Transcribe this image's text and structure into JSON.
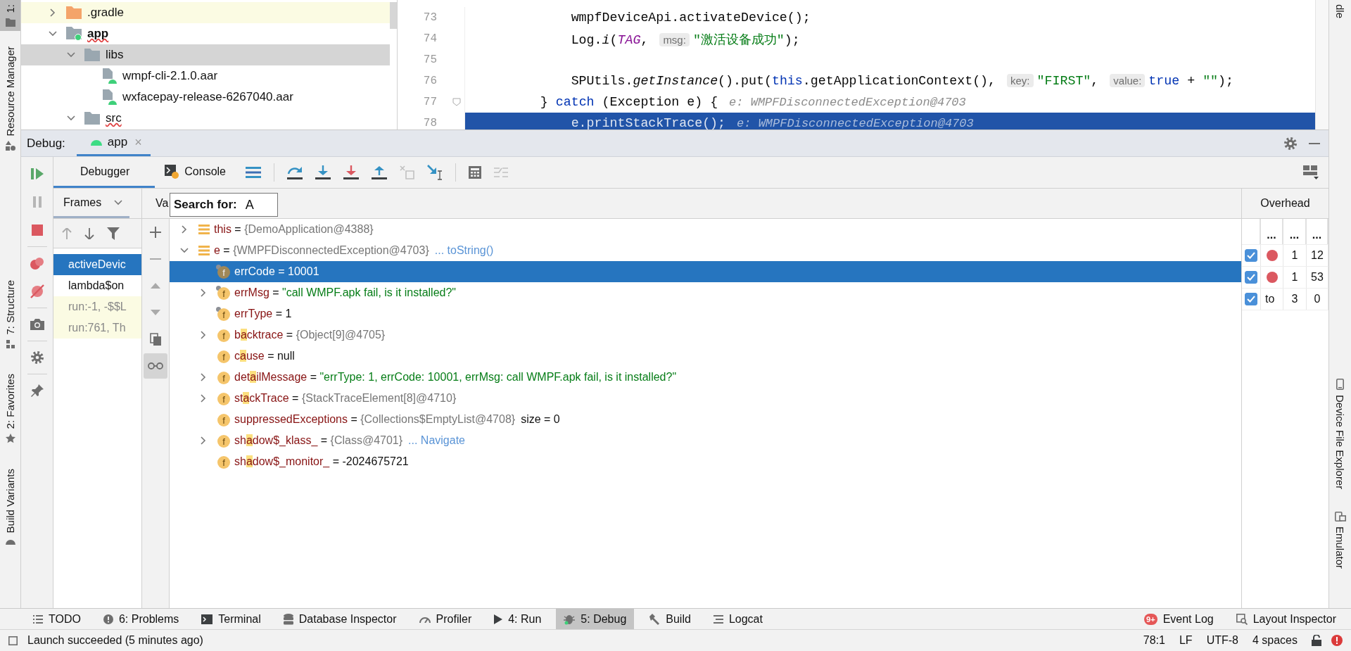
{
  "left_strip": [
    {
      "label": "1:",
      "kind": "project",
      "selected": true
    },
    {
      "label": "Resource Manager",
      "kind": "resources",
      "selected": false
    },
    {
      "label": "7: Structure",
      "kind": "structure",
      "selected": false
    },
    {
      "label": "2: Favorites",
      "kind": "favorites",
      "selected": false
    },
    {
      "label": "Build Variants",
      "kind": "variants",
      "selected": false
    }
  ],
  "right_strip": [
    {
      "label": "dle",
      "kind": "gradle"
    },
    {
      "label": "Device File Explorer",
      "kind": "device"
    },
    {
      "label": "Emulator",
      "kind": "emulator"
    }
  ],
  "project_tree": [
    {
      "label": ".gradle",
      "kind": "folder",
      "expanded": false,
      "excluded": true,
      "selected": false,
      "warning": false
    },
    {
      "label": "app",
      "kind": "module",
      "expanded": true,
      "excluded": false,
      "selected": false,
      "warning": true,
      "children": [
        {
          "label": "libs",
          "kind": "folder",
          "expanded": true,
          "excluded": false,
          "selected": true,
          "warning": false,
          "children": [
            {
              "label": "wmpf-cli-2.1.0.aar",
              "kind": "archive",
              "excluded": false,
              "selected": false,
              "warning": false
            },
            {
              "label": "wxfacepay-release-6267040.aar",
              "kind": "archive",
              "excluded": false,
              "selected": false,
              "warning": false
            }
          ]
        },
        {
          "label": "src",
          "kind": "folder",
          "expanded": true,
          "excluded": false,
          "selected": false,
          "warning": true
        }
      ]
    }
  ],
  "editor": {
    "lines": [
      {
        "number": "73",
        "current": false,
        "fold": false,
        "tokens": [
          {
            "kind": "plain",
            "text": "            wmpfDeviceApi.activateDevice();"
          }
        ]
      },
      {
        "number": "74",
        "current": false,
        "fold": false,
        "tokens": [
          {
            "kind": "plain",
            "text": "            Log."
          },
          {
            "kind": "italic",
            "text": "i"
          },
          {
            "kind": "plain",
            "text": "("
          },
          {
            "kind": "constant",
            "text": "TAG"
          },
          {
            "kind": "plain",
            "text": ", "
          },
          {
            "kind": "hint",
            "text": "msg:"
          },
          {
            "kind": "string",
            "text": "\"激活设备成功\""
          },
          {
            "kind": "plain",
            "text": ");"
          }
        ]
      },
      {
        "number": "75",
        "current": false,
        "fold": false
      },
      {
        "number": "76",
        "current": false,
        "fold": false,
        "tokens": [
          {
            "kind": "plain",
            "text": "            SPUtils."
          },
          {
            "kind": "italic",
            "text": "getInstance"
          },
          {
            "kind": "plain",
            "text": "().put("
          },
          {
            "kind": "keyword",
            "text": "this"
          },
          {
            "kind": "plain",
            "text": ".getApplicationContext(), "
          },
          {
            "kind": "hint",
            "text": "key:"
          },
          {
            "kind": "string",
            "text": "\"FIRST\""
          },
          {
            "kind": "plain",
            "text": ", "
          },
          {
            "kind": "hint",
            "text": "value:"
          },
          {
            "kind": "keyword",
            "text": "true"
          },
          {
            "kind": "plain",
            "text": " + "
          },
          {
            "kind": "string",
            "text": "\"\""
          },
          {
            "kind": "plain",
            "text": ");"
          }
        ]
      },
      {
        "number": "77",
        "current": false,
        "fold": true,
        "tokens": [
          {
            "kind": "plain",
            "text": "        } "
          },
          {
            "kind": "keyword",
            "text": "catch"
          },
          {
            "kind": "plain",
            "text": " (Exception e) {"
          }
        ],
        "inline_value": "e: WMPFDisconnectedException@4703"
      },
      {
        "number": "78",
        "current": true,
        "fold": false,
        "tokens": [
          {
            "kind": "plain",
            "text": "            e.printStackTrace();"
          }
        ],
        "inline_value": "e: WMPFDisconnectedException@4703"
      }
    ]
  },
  "debug": {
    "title": "Debug:",
    "sessions": [
      {
        "label": "app",
        "close": "×",
        "selected": true
      }
    ],
    "side_buttons": [
      {
        "kind": "resume",
        "disabled": false
      },
      {
        "kind": "pause",
        "disabled": true
      },
      {
        "kind": "stop",
        "disabled": false
      },
      {
        "kind": "breakpoints",
        "disabled": false
      },
      {
        "kind": "mute",
        "disabled": false
      },
      {
        "kind": "camera",
        "disabled": false
      },
      {
        "kind": "settings",
        "disabled": false
      },
      {
        "kind": "pin",
        "disabled": false
      }
    ],
    "tabs": [
      {
        "label": "Debugger",
        "kind": "debugger",
        "selected": true
      },
      {
        "label": "Console",
        "kind": "console",
        "selected": false
      }
    ],
    "toolbar": [
      {
        "kind": "show-execution-point",
        "disabled": false
      },
      {
        "kind": "step-over",
        "disabled": false
      },
      {
        "kind": "step-into",
        "disabled": false
      },
      {
        "kind": "force-step-into",
        "disabled": false
      },
      {
        "kind": "step-out",
        "disabled": false
      },
      {
        "kind": "drop-frame",
        "disabled": true
      },
      {
        "kind": "run-to-cursor",
        "disabled": false
      },
      {
        "kind": "evaluate",
        "disabled": false
      },
      {
        "kind": "trace",
        "disabled": true
      }
    ],
    "frames": {
      "title": "Frames",
      "tools": [
        {
          "kind": "up",
          "disabled": true
        },
        {
          "kind": "down",
          "disabled": false
        },
        {
          "kind": "filter",
          "disabled": false
        }
      ],
      "items": [
        {
          "label": "activeDevic",
          "selected": true,
          "library": false
        },
        {
          "label": "lambda$on",
          "selected": false,
          "library": false
        },
        {
          "label": "run:-1, -$$L",
          "selected": false,
          "library": true
        },
        {
          "label": "run:761, Th",
          "selected": false,
          "library": true
        }
      ]
    },
    "variables": {
      "title": "Va",
      "search": {
        "label": "Search for:",
        "value": "A"
      },
      "tools": [
        {
          "kind": "add",
          "disabled": false,
          "selected": false
        },
        {
          "kind": "remove",
          "disabled": true,
          "selected": false
        },
        {
          "kind": "up",
          "disabled": true,
          "selected": false
        },
        {
          "kind": "down",
          "disabled": true,
          "selected": false
        },
        {
          "kind": "copy",
          "disabled": false,
          "selected": false
        },
        {
          "kind": "watches",
          "disabled": false,
          "selected": true
        }
      ],
      "items": [
        {
          "kind": "watch",
          "name": [
            "this"
          ],
          "sep": "=",
          "value": {
            "kind": "object",
            "text": "{DemoApplication@4388}"
          },
          "expanded": false,
          "selected": false
        },
        {
          "kind": "watch",
          "name": [
            "e"
          ],
          "sep": "=",
          "value": {
            "kind": "object",
            "text": "{WMPFDisconnectedException@4703}"
          },
          "link": "... toString()",
          "expanded": true,
          "selected": false,
          "children": [
            {
              "kind": "field",
              "badge": "f",
              "marked": true,
              "name": [
                "errCode"
              ],
              "sep": "=",
              "value": {
                "kind": "number",
                "text": "10001"
              },
              "selected": true
            },
            {
              "kind": "field",
              "badge": "f",
              "marked": true,
              "name": [
                "errMsg"
              ],
              "sep": "=",
              "value": {
                "kind": "string",
                "text": "\"call WMPF.apk fail, is it installed?\""
              },
              "expanded": false,
              "selected": false
            },
            {
              "kind": "field",
              "badge": "f",
              "marked": true,
              "name": [
                "errType"
              ],
              "sep": "=",
              "value": {
                "kind": "number",
                "text": "1"
              },
              "selected": false
            },
            {
              "kind": "field",
              "badge": "f",
              "marked": false,
              "name": [
                "b",
                "a",
                "cktrace"
              ],
              "sep": "=",
              "value": {
                "kind": "object",
                "text": "{Object[9]@4705}"
              },
              "expanded": false,
              "selected": false
            },
            {
              "kind": "field",
              "badge": "f",
              "marked": false,
              "name": [
                "c",
                "a",
                "use"
              ],
              "sep": "=",
              "value": {
                "kind": "number",
                "text": "null"
              },
              "selected": false
            },
            {
              "kind": "field",
              "badge": "f",
              "marked": false,
              "name": [
                "det",
                "a",
                "ilMessage"
              ],
              "sep": "=",
              "value": {
                "kind": "string",
                "text": "\"errType: 1, errCode: 10001, errMsg: call WMPF.apk fail, is it installed?\""
              },
              "expanded": false,
              "selected": false
            },
            {
              "kind": "field",
              "badge": "f",
              "marked": false,
              "name": [
                "st",
                "a",
                "ckTrace"
              ],
              "sep": "=",
              "value": {
                "kind": "object",
                "text": "{StackTraceElement[8]@4710}"
              },
              "expanded": false,
              "selected": false
            },
            {
              "kind": "field",
              "badge": "f",
              "marked": false,
              "name": [
                "suppressedExceptions"
              ],
              "sep": "=",
              "value": {
                "kind": "object",
                "text": "{Collections$EmptyList@4708}"
              },
              "extra": "size = 0",
              "selected": false
            },
            {
              "kind": "field",
              "badge": "f",
              "marked": false,
              "name": [
                "sh",
                "a",
                "dow$_klass_"
              ],
              "sep": "=",
              "value": {
                "kind": "object",
                "text": "{Class@4701}"
              },
              "link": "... Navigate",
              "expanded": false,
              "selected": false
            },
            {
              "kind": "field",
              "badge": "f",
              "marked": false,
              "name": [
                "sh",
                "a",
                "dow$_monitor_"
              ],
              "sep": "=",
              "value": {
                "kind": "number",
                "text": "-2024675721"
              },
              "selected": false
            }
          ]
        }
      ]
    },
    "overhead": {
      "title": "Overhead",
      "columns": [
        "...",
        "...",
        "..."
      ],
      "rows": [
        {
          "enabled": true,
          "kind": "breakpoint",
          "cells": [
            "",
            "1",
            "12"
          ]
        },
        {
          "enabled": true,
          "kind": "breakpoint",
          "cells": [
            "",
            "1",
            "53"
          ]
        },
        {
          "enabled": true,
          "kind": "label",
          "cells": [
            "to",
            "3",
            "0"
          ]
        }
      ]
    }
  },
  "tool_windows": [
    {
      "label": "TODO",
      "kind": "todo",
      "selected": false
    },
    {
      "label": "6: Problems",
      "kind": "problems",
      "selected": false
    },
    {
      "label": "Terminal",
      "kind": "terminal",
      "selected": false
    },
    {
      "label": "Database Inspector",
      "kind": "database",
      "selected": false
    },
    {
      "label": "Profiler",
      "kind": "profiler",
      "selected": false
    },
    {
      "label": "4: Run",
      "kind": "run",
      "selected": false
    },
    {
      "label": "5: Debug",
      "kind": "debug",
      "selected": true
    },
    {
      "label": "Build",
      "kind": "build",
      "selected": false
    },
    {
      "label": "Logcat",
      "kind": "logcat",
      "selected": false
    }
  ],
  "tool_windows_right": [
    {
      "label": "Event Log",
      "kind": "event-log",
      "badge": "9+",
      "selected": false
    },
    {
      "label": "Layout Inspector",
      "kind": "layout-inspector",
      "selected": false
    }
  ],
  "status_bar": {
    "message": "Launch succeeded (5 minutes ago)",
    "items": [
      "78:1",
      "LF",
      "UTF-8",
      "4 spaces"
    ]
  }
}
